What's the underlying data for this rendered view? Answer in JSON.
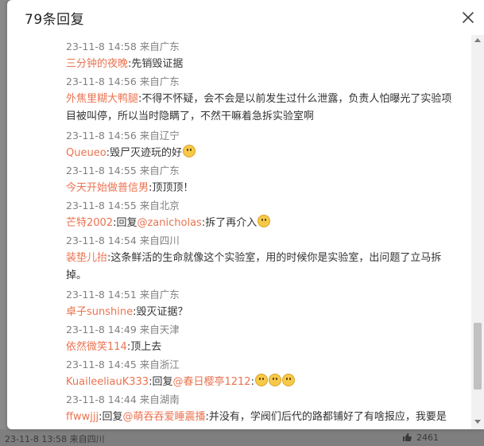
{
  "modal": {
    "title": "79条回复"
  },
  "replies": [
    {
      "meta": "23-11-8 14:58 来自广东",
      "user": "三分钟的夜晚",
      "text": ":先销毁证据"
    },
    {
      "meta": "23-11-8 14:56 来自广东",
      "user": "外焦里糊大鸭腿",
      "text": ":不得不怀疑，会不会是以前发生过什么泄露，负责人怕曝光了实验项",
      "text2": "目被叫停，所以当时隐瞒了，不然干嘛着急拆实验室啊"
    },
    {
      "meta": "23-11-8 14:56 来自辽宁",
      "user": "Queueo",
      "text": ":毁尸灭迹玩的好"
    },
    {
      "meta": "23-11-8 14:55 来自广东",
      "user": "今天开始做普信男",
      "text": ":顶顶顶！"
    },
    {
      "meta": "23-11-8 14:55 来自北京",
      "user": "芒特2002",
      "reply": ":回复",
      "mention": "@zanicholas",
      "text": ":拆了再介入"
    },
    {
      "meta": "23-11-8 14:54 来自四川",
      "user": "装垫儿抬",
      "text": ":这条鲜活的生命就像这个实验室，用的时候你是实验室，出问题了立马拆",
      "text2": "掉。"
    },
    {
      "meta": "23-11-8 14:51 来自广东",
      "user": "卓子sunshine",
      "text": ":毁灭证据？"
    },
    {
      "meta": "23-11-8 14:49 来自天津",
      "user": "依然微笑114",
      "text": ":顶上去"
    },
    {
      "meta": "23-11-8 14:45 来自浙江",
      "user": "KuaileeliauK333",
      "reply": ":回复",
      "mention": "@春日樱亭1212",
      "text": ":"
    },
    {
      "meta": "23-11-8 14:44 来自湖南",
      "user": "ffwwjjj",
      "reply": ":回复",
      "mention": "@萌吞吞爱睡震播",
      "text": ":并没有，学阀们后代的路都铺好了有啥报应，我要是"
    }
  ],
  "background": {
    "timestamp": "23-11-8 13:58 来自四川",
    "like_count": "2461"
  },
  "icons": {
    "close": "close-icon",
    "emoji": "emoji-icon",
    "like": "thumb-up-icon"
  },
  "colors": {
    "username": "#eb7350",
    "meta": "#808080",
    "text": "#333333"
  }
}
